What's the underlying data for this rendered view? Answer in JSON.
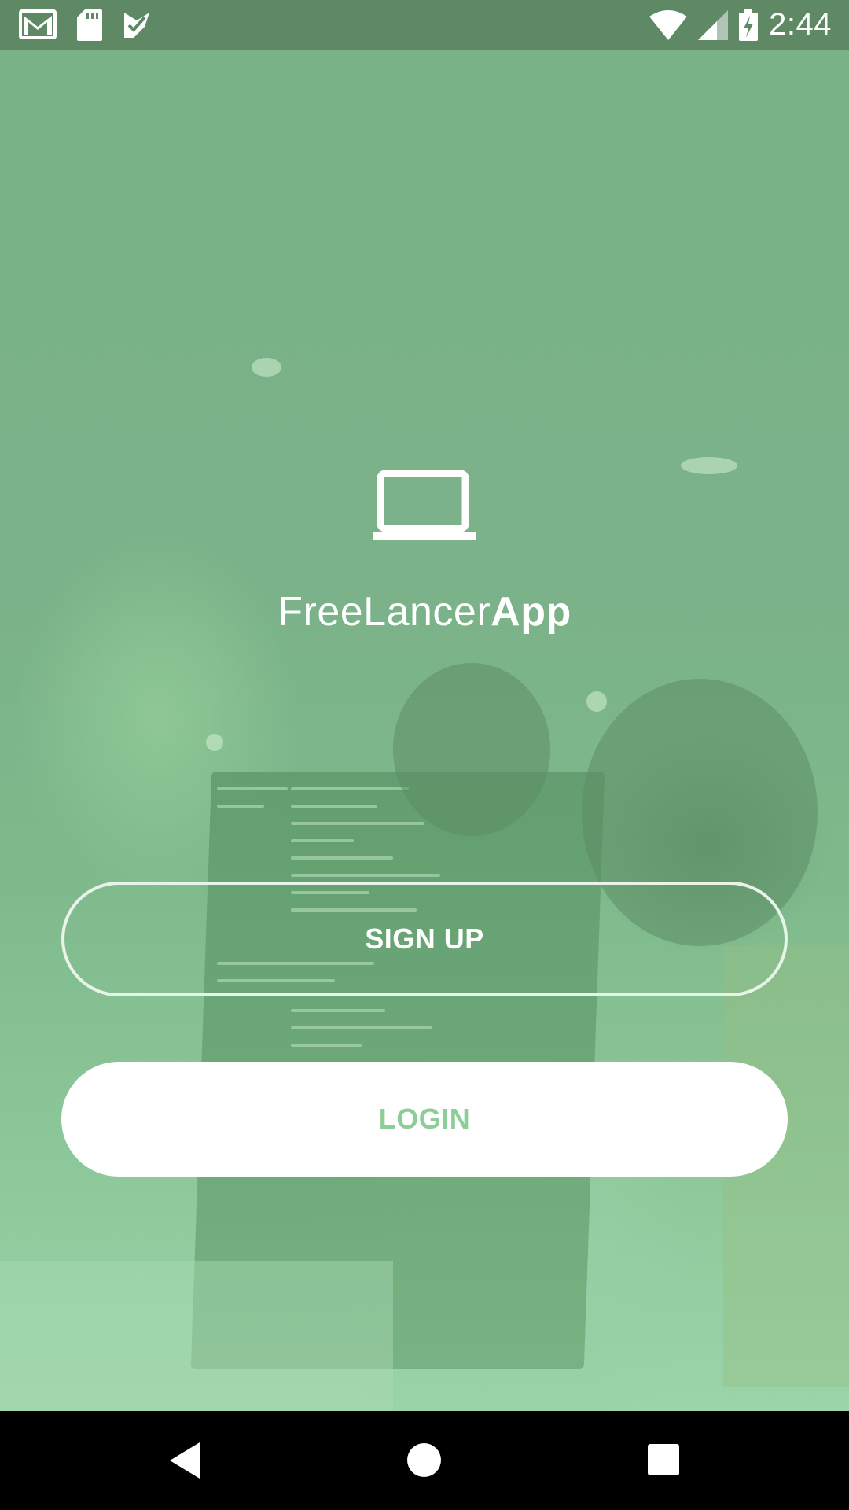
{
  "status_bar": {
    "time": "2:44",
    "left_icons": [
      "gmail-icon",
      "sd-card-icon",
      "task-check-icon"
    ],
    "right_icons": [
      "wifi-icon",
      "cell-signal-icon",
      "battery-charging-icon"
    ]
  },
  "logo": {
    "icon": "laptop-icon",
    "title_regular": "FreeLancer",
    "title_bold": "App"
  },
  "buttons": {
    "signup_label": "SIGN UP",
    "login_label": "LOGIN"
  },
  "navigation": {
    "icons": [
      "back-icon",
      "home-icon",
      "recent-apps-icon"
    ]
  },
  "colors": {
    "status_bar": "#5e8964",
    "background_tint": "#7ab489",
    "login_text": "#8ccd98",
    "nav_bar": "#000000"
  }
}
